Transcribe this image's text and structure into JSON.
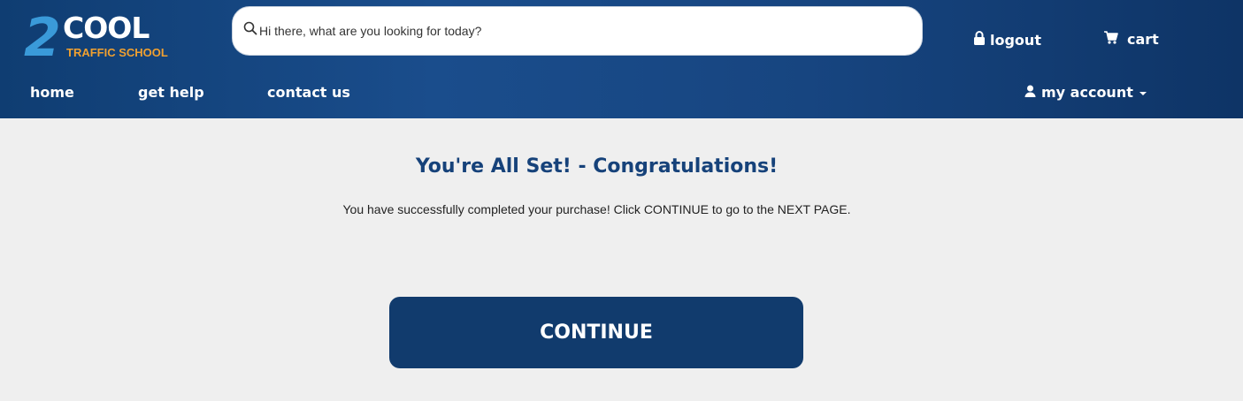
{
  "brand": {
    "logo_number": "2",
    "logo_word": "COOL",
    "logo_tagline": "TRAFFIC SCHOOL",
    "primary_color": "#113b6d",
    "accent_blue": "#3a9ad9",
    "accent_orange": "#f0a030"
  },
  "search": {
    "placeholder": "Hi there, what are you looking for today?",
    "icon": "search-icon"
  },
  "header_links": {
    "logout_label": "logout",
    "logout_icon": "lock-icon",
    "cart_label": "cart",
    "cart_icon": "cart-icon"
  },
  "nav": {
    "items": [
      {
        "label": "home"
      },
      {
        "label": "get help"
      },
      {
        "label": "contact us"
      }
    ],
    "account_label": "my account",
    "account_icon": "user-icon"
  },
  "main": {
    "title": "You're All Set! - Congratulations!",
    "message": "You have successfully completed your purchase! Click CONTINUE to go to the NEXT PAGE.",
    "continue_label": "CONTINUE"
  }
}
